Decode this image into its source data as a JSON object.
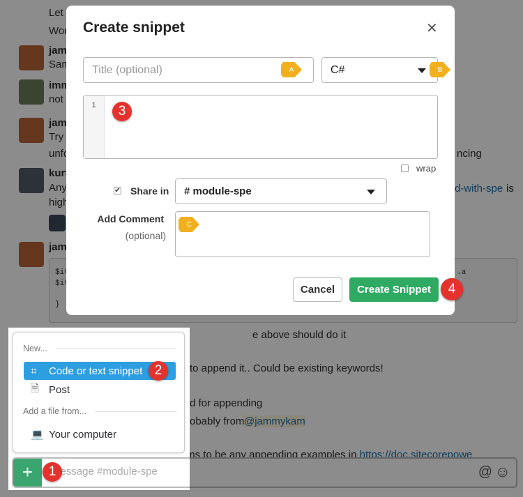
{
  "chat": {
    "lines": [
      "Let",
      "Wor",
      "jam",
      "Sam",
      "imm",
      "not",
      "jam",
      "Try",
      "unfo",
      "ncing",
      "kurt",
      "Any",
      "high",
      "d-with-spe",
      "is",
      "jam"
    ],
    "code_lines": [
      "$it",
      "$it",
      "}"
    ],
    "code_suffix": ".a",
    "msg1": "e above should do it",
    "msg2": "to append it.. Could be existing keywords!",
    "msg3": "d for appending",
    "msg4": "obably from",
    "mention": "@jammykam",
    "msg5": "I might be blind... Doesn't seems to be any appending examples in",
    "msg5_link": "https://doc.sitecorepowe"
  },
  "composer": {
    "placeholder": "Message #module-spe",
    "plus": "+",
    "at_icon": "@",
    "emoji_icon": "☺"
  },
  "modal": {
    "title": "Create snippet",
    "close": "✕",
    "title_placeholder": "Title (optional)",
    "language": "C#",
    "line_number": "1",
    "wrap_label": "wrap",
    "wrap_checked": false,
    "share_label": "Share in",
    "share_checked": true,
    "channel": "# module-spe",
    "comment_label": "Add Comment",
    "comment_sub": "(optional)",
    "cancel": "Cancel",
    "create": "Create Snippet"
  },
  "menu": {
    "section_new": "New...",
    "items": [
      {
        "label": "Code or text snippet",
        "icon": "snippet-icon",
        "selected": true
      },
      {
        "label": "Post",
        "icon": "document-icon"
      }
    ],
    "section_file": "Add a file from...",
    "file_items": [
      {
        "label": "Your computer",
        "icon": "computer-icon"
      }
    ]
  },
  "annotations": {
    "badges": [
      "1",
      "2",
      "3",
      "4"
    ],
    "tags": [
      "A",
      "B",
      "C"
    ]
  },
  "colors": {
    "accent_green": "#2eaa63",
    "selected_blue": "#2d9ee0",
    "badge_red": "#e5322d",
    "tag_yellow": "#f2b01e"
  }
}
